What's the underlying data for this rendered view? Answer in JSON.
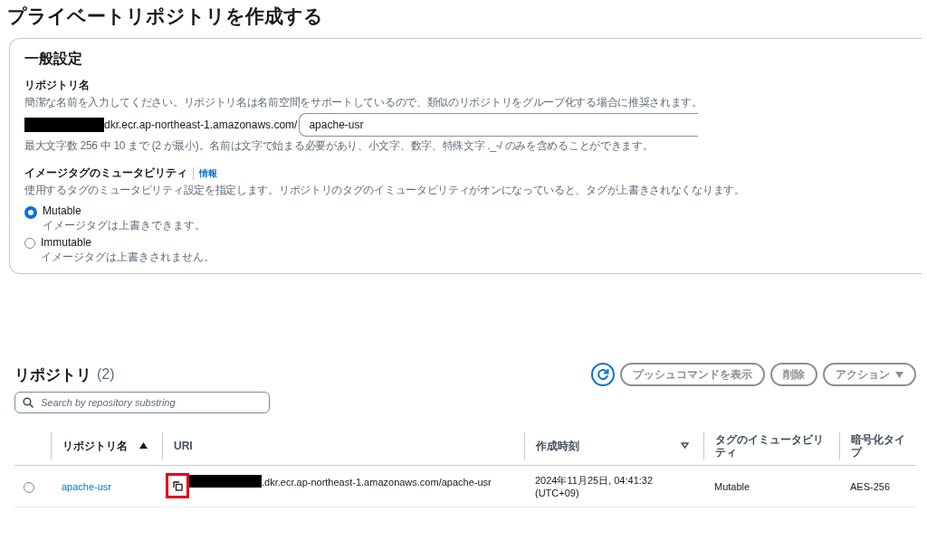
{
  "page_title": "プライベートリポジトリを作成する",
  "general": {
    "title": "一般設定",
    "repo_name": {
      "label": "リポジトリ名",
      "description": "簡潔な名前を入力してください。リポジトリ名は名前空間をサポートしているので、類似のリポジトリをグループ化する場合に推奨されます。",
      "prefix": "dkr.ecr.ap-northeast-1.amazonaws.com/",
      "value": "apache-usr",
      "hint": "最大文字数 256 中 10 まで (2 が最小)。名前は文字で始まる必要があり、小文字、数字、特殊文字 ._-/ のみを含めることができます。"
    },
    "mutability": {
      "label": "イメージタグのミュータビリティ",
      "info": "情報",
      "description": "使用するタグのミュータビリティ設定を指定します。リポジトリのタグのイミュータビリティがオンになっていると、タグが上書きされなくなります。",
      "options": [
        {
          "label": "Mutable",
          "description": "イメージタグは上書きできます。",
          "selected": true
        },
        {
          "label": "Immutable",
          "description": "イメージタグは上書きされません。",
          "selected": false
        }
      ]
    }
  },
  "repositories": {
    "title": "リポジトリ",
    "count": "(2)",
    "buttons": [
      {
        "kind": "refresh"
      },
      {
        "kind": "text",
        "label": "プッシュコマンドを表示"
      },
      {
        "kind": "text",
        "label": "削除"
      },
      {
        "kind": "menu",
        "label": "アクション"
      }
    ],
    "search": {
      "placeholder": "Search by repository substring"
    },
    "columns": [
      {
        "label": "リポジトリ名",
        "sortable": true,
        "sorted": true
      },
      {
        "label": "URI",
        "sortable": false,
        "sorted": false
      },
      {
        "label": "作成時刻",
        "sortable": true,
        "sorted": false
      },
      {
        "label": "タグのイミュータビリティ",
        "sortable": false,
        "sorted": false
      },
      {
        "label": "暗号化タイプ",
        "sortable": false,
        "sorted": false
      }
    ],
    "rows": [
      {
        "selected": false,
        "name": "apache-usr",
        "uri": ".dkr.ecr.ap-northeast-1.amazonaws.com/apache-usr",
        "created": "2024年11月25日, 04:41:32 (UTC+09)",
        "mutability": "Mutable",
        "encryption": "AES-256"
      }
    ]
  }
}
